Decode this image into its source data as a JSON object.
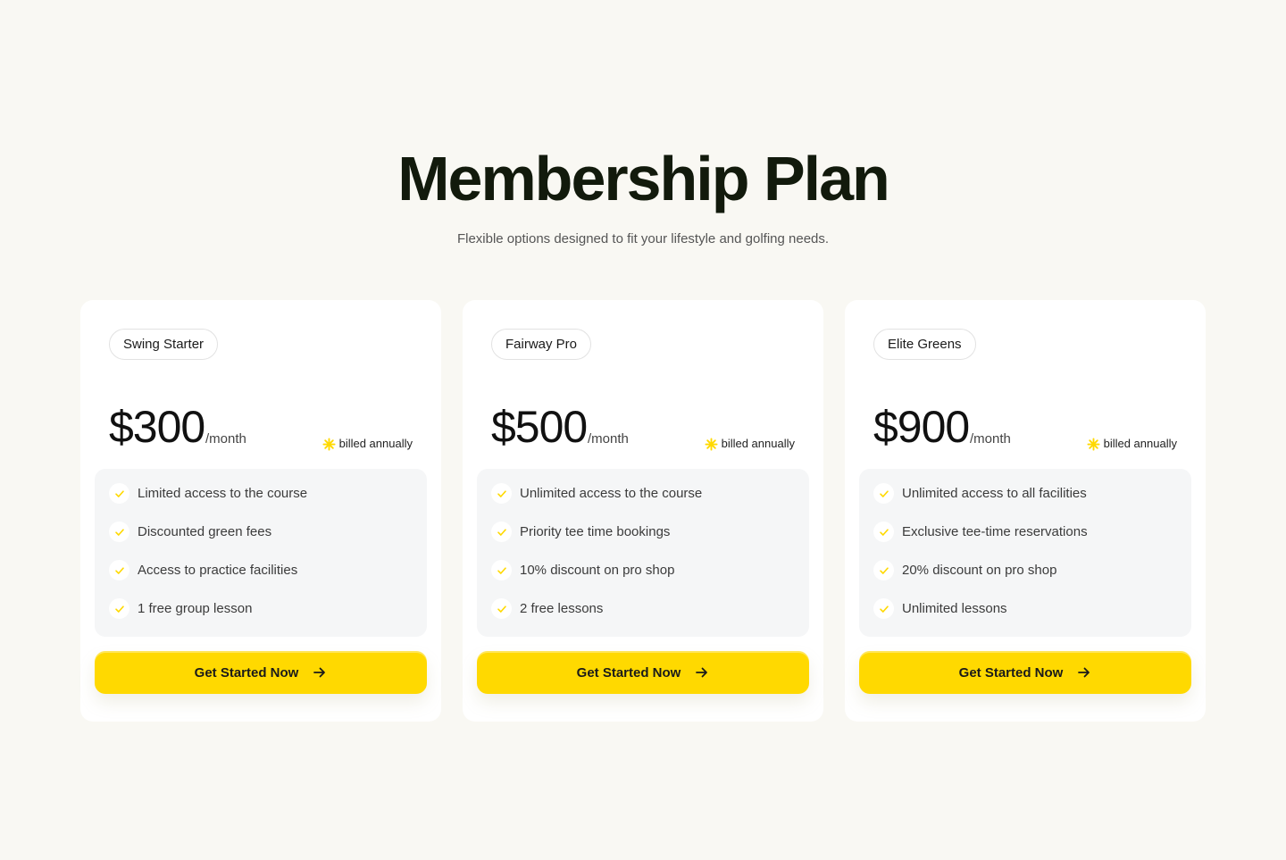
{
  "header": {
    "title": "Membership Plan",
    "subtitle": "Flexible options designed to fit your lifestyle and golfing needs."
  },
  "colors": {
    "accent": "#ffd900",
    "background": "#f9f8f3",
    "card": "#ffffff",
    "feature_panel": "#f5f6f7"
  },
  "plans": [
    {
      "name": "Swing Starter",
      "price": "$300",
      "period": "/month",
      "billing": "billed annually",
      "features": [
        "Limited access to the course",
        "Discounted green fees",
        "Access to practice facilities",
        "1 free group lesson"
      ],
      "cta": "Get Started Now"
    },
    {
      "name": "Fairway Pro",
      "price": "$500",
      "period": "/month",
      "billing": "billed annually",
      "features": [
        "Unlimited access to the course",
        "Priority tee time bookings",
        "10% discount on pro shop",
        "2 free lessons"
      ],
      "cta": "Get Started Now"
    },
    {
      "name": "Elite Greens",
      "price": "$900",
      "period": "/month",
      "billing": "billed annually",
      "features": [
        "Unlimited access to all facilities",
        "Exclusive tee-time reservations",
        "20% discount on pro shop",
        "Unlimited lessons"
      ],
      "cta": "Get Started Now"
    }
  ],
  "icons": {
    "billing": "sparkle-icon",
    "feature": "check-icon",
    "cta": "arrow-right-icon"
  }
}
